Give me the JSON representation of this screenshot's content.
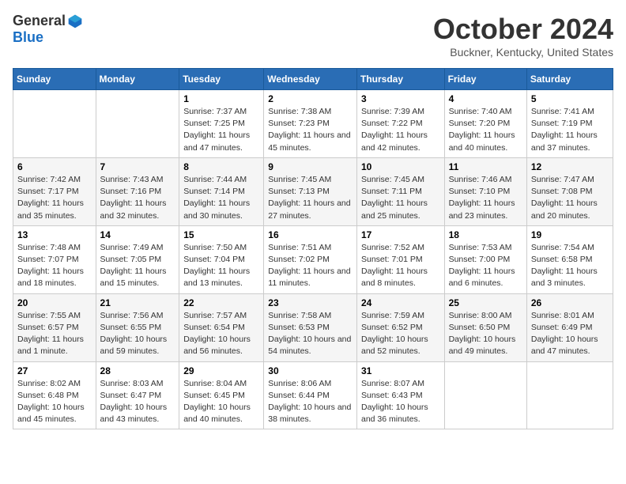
{
  "header": {
    "logo_general": "General",
    "logo_blue": "Blue",
    "month": "October 2024",
    "location": "Buckner, Kentucky, United States"
  },
  "days_of_week": [
    "Sunday",
    "Monday",
    "Tuesday",
    "Wednesday",
    "Thursday",
    "Friday",
    "Saturday"
  ],
  "weeks": [
    [
      {
        "day": "",
        "info": ""
      },
      {
        "day": "",
        "info": ""
      },
      {
        "day": "1",
        "info": "Sunrise: 7:37 AM\nSunset: 7:25 PM\nDaylight: 11 hours and 47 minutes."
      },
      {
        "day": "2",
        "info": "Sunrise: 7:38 AM\nSunset: 7:23 PM\nDaylight: 11 hours and 45 minutes."
      },
      {
        "day": "3",
        "info": "Sunrise: 7:39 AM\nSunset: 7:22 PM\nDaylight: 11 hours and 42 minutes."
      },
      {
        "day": "4",
        "info": "Sunrise: 7:40 AM\nSunset: 7:20 PM\nDaylight: 11 hours and 40 minutes."
      },
      {
        "day": "5",
        "info": "Sunrise: 7:41 AM\nSunset: 7:19 PM\nDaylight: 11 hours and 37 minutes."
      }
    ],
    [
      {
        "day": "6",
        "info": "Sunrise: 7:42 AM\nSunset: 7:17 PM\nDaylight: 11 hours and 35 minutes."
      },
      {
        "day": "7",
        "info": "Sunrise: 7:43 AM\nSunset: 7:16 PM\nDaylight: 11 hours and 32 minutes."
      },
      {
        "day": "8",
        "info": "Sunrise: 7:44 AM\nSunset: 7:14 PM\nDaylight: 11 hours and 30 minutes."
      },
      {
        "day": "9",
        "info": "Sunrise: 7:45 AM\nSunset: 7:13 PM\nDaylight: 11 hours and 27 minutes."
      },
      {
        "day": "10",
        "info": "Sunrise: 7:45 AM\nSunset: 7:11 PM\nDaylight: 11 hours and 25 minutes."
      },
      {
        "day": "11",
        "info": "Sunrise: 7:46 AM\nSunset: 7:10 PM\nDaylight: 11 hours and 23 minutes."
      },
      {
        "day": "12",
        "info": "Sunrise: 7:47 AM\nSunset: 7:08 PM\nDaylight: 11 hours and 20 minutes."
      }
    ],
    [
      {
        "day": "13",
        "info": "Sunrise: 7:48 AM\nSunset: 7:07 PM\nDaylight: 11 hours and 18 minutes."
      },
      {
        "day": "14",
        "info": "Sunrise: 7:49 AM\nSunset: 7:05 PM\nDaylight: 11 hours and 15 minutes."
      },
      {
        "day": "15",
        "info": "Sunrise: 7:50 AM\nSunset: 7:04 PM\nDaylight: 11 hours and 13 minutes."
      },
      {
        "day": "16",
        "info": "Sunrise: 7:51 AM\nSunset: 7:02 PM\nDaylight: 11 hours and 11 minutes."
      },
      {
        "day": "17",
        "info": "Sunrise: 7:52 AM\nSunset: 7:01 PM\nDaylight: 11 hours and 8 minutes."
      },
      {
        "day": "18",
        "info": "Sunrise: 7:53 AM\nSunset: 7:00 PM\nDaylight: 11 hours and 6 minutes."
      },
      {
        "day": "19",
        "info": "Sunrise: 7:54 AM\nSunset: 6:58 PM\nDaylight: 11 hours and 3 minutes."
      }
    ],
    [
      {
        "day": "20",
        "info": "Sunrise: 7:55 AM\nSunset: 6:57 PM\nDaylight: 11 hours and 1 minute."
      },
      {
        "day": "21",
        "info": "Sunrise: 7:56 AM\nSunset: 6:55 PM\nDaylight: 10 hours and 59 minutes."
      },
      {
        "day": "22",
        "info": "Sunrise: 7:57 AM\nSunset: 6:54 PM\nDaylight: 10 hours and 56 minutes."
      },
      {
        "day": "23",
        "info": "Sunrise: 7:58 AM\nSunset: 6:53 PM\nDaylight: 10 hours and 54 minutes."
      },
      {
        "day": "24",
        "info": "Sunrise: 7:59 AM\nSunset: 6:52 PM\nDaylight: 10 hours and 52 minutes."
      },
      {
        "day": "25",
        "info": "Sunrise: 8:00 AM\nSunset: 6:50 PM\nDaylight: 10 hours and 49 minutes."
      },
      {
        "day": "26",
        "info": "Sunrise: 8:01 AM\nSunset: 6:49 PM\nDaylight: 10 hours and 47 minutes."
      }
    ],
    [
      {
        "day": "27",
        "info": "Sunrise: 8:02 AM\nSunset: 6:48 PM\nDaylight: 10 hours and 45 minutes."
      },
      {
        "day": "28",
        "info": "Sunrise: 8:03 AM\nSunset: 6:47 PM\nDaylight: 10 hours and 43 minutes."
      },
      {
        "day": "29",
        "info": "Sunrise: 8:04 AM\nSunset: 6:45 PM\nDaylight: 10 hours and 40 minutes."
      },
      {
        "day": "30",
        "info": "Sunrise: 8:06 AM\nSunset: 6:44 PM\nDaylight: 10 hours and 38 minutes."
      },
      {
        "day": "31",
        "info": "Sunrise: 8:07 AM\nSunset: 6:43 PM\nDaylight: 10 hours and 36 minutes."
      },
      {
        "day": "",
        "info": ""
      },
      {
        "day": "",
        "info": ""
      }
    ]
  ]
}
